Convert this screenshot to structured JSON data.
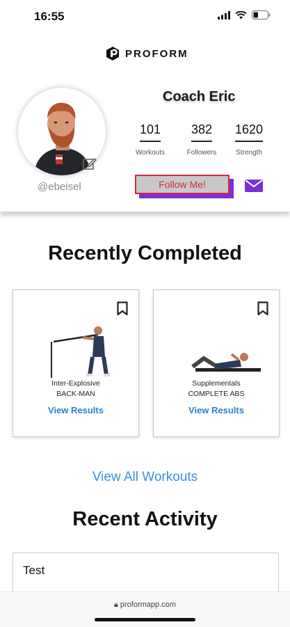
{
  "status_bar": {
    "time": "16:55",
    "battery_level": 0.35
  },
  "brand": {
    "logo_text": "PROFORM",
    "accent_color": "#7b2fd6"
  },
  "profile": {
    "name": "Coach Eric",
    "handle": "@ebeisel",
    "stats": [
      {
        "value": "101",
        "label": "Workouts"
      },
      {
        "value": "382",
        "label": "Followers"
      },
      {
        "value": "1620",
        "label": "Strength"
      }
    ],
    "follow_label": "Follow Me!",
    "follow_colors": {
      "text": "#d62839",
      "shadow": "#7b2fd6",
      "background": "#c8c8c8"
    }
  },
  "recently_completed": {
    "title": "Recently Completed",
    "workouts": [
      {
        "category": "Inter-Explosive",
        "name": "BACK-MAN",
        "action": "View Results"
      },
      {
        "category": "Supplementals",
        "name": "COMPLETE ABS",
        "action": "View Results"
      }
    ],
    "view_all": "View All Workouts"
  },
  "recent_activity": {
    "title": "Recent Activity",
    "items": [
      {
        "text": "Test"
      }
    ]
  },
  "browser": {
    "url": "proformapp.com"
  }
}
